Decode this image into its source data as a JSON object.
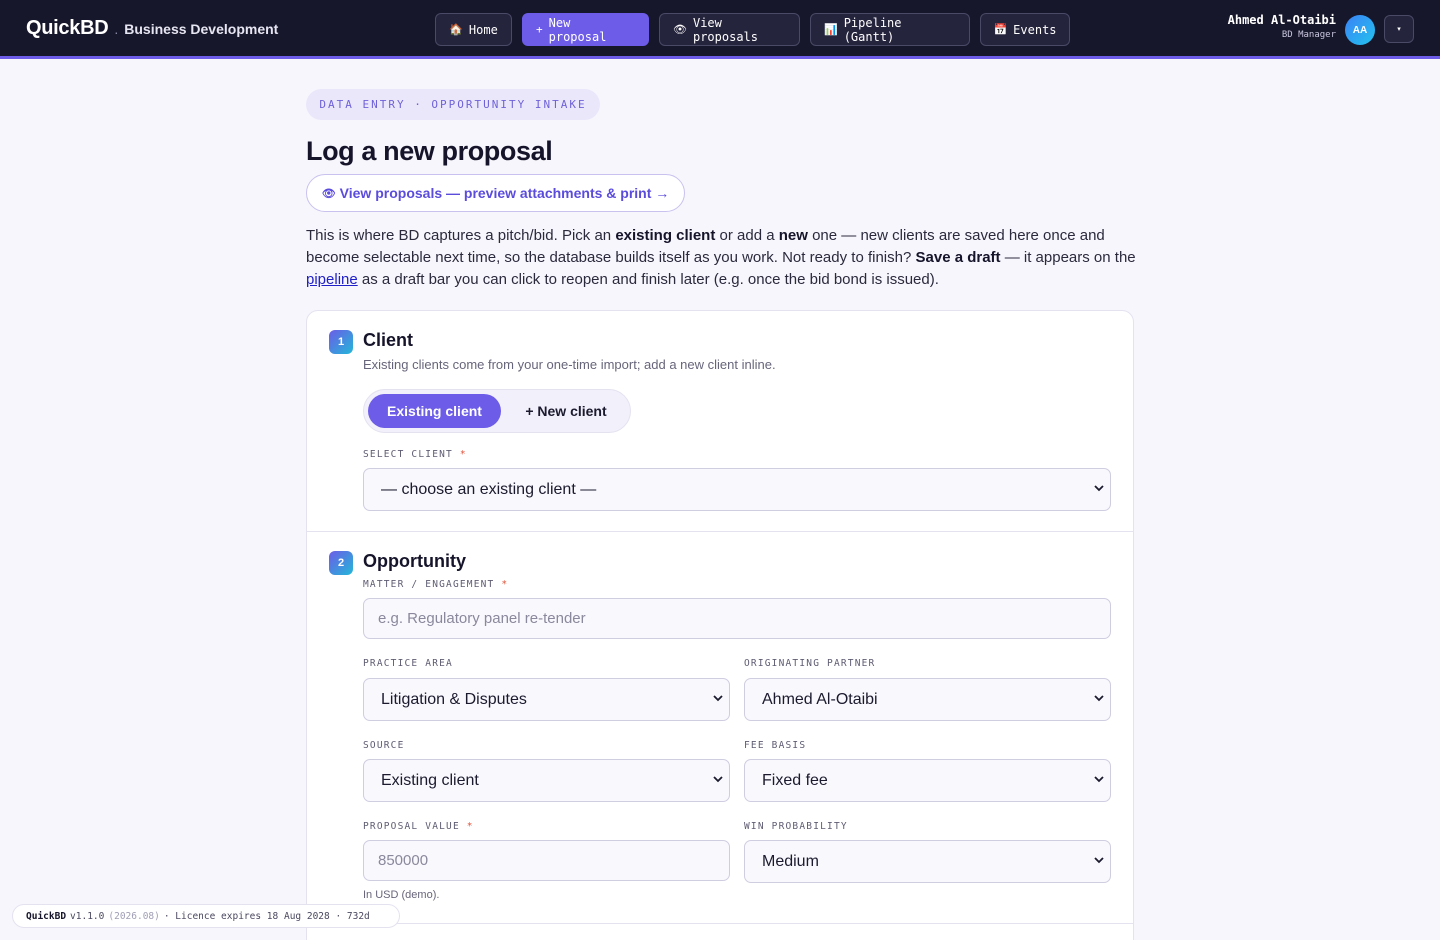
{
  "app": {
    "brand_name": "QuickBD",
    "brand_separator": ".",
    "brand_subtitle": "Business Development"
  },
  "nav": [
    {
      "label": "Home",
      "icon": "home-icon",
      "glyph": "🏠"
    },
    {
      "label": "New proposal",
      "icon": "plus-icon",
      "glyph": "+"
    },
    {
      "label": "View proposals",
      "icon": "eye-icon",
      "glyph": "👁"
    },
    {
      "label": "Pipeline (Gantt)",
      "icon": "chart-icon",
      "glyph": "📊"
    },
    {
      "label": "Events",
      "icon": "calendar-icon",
      "glyph": "📅"
    }
  ],
  "user": {
    "name": "Ahmed Al-Otaibi",
    "role": "BD Manager",
    "initials": "AA",
    "menu_glyph": "▾"
  },
  "header": {
    "eyebrow": "DATA ENTRY · OPPORTUNITY INTAKE",
    "title": "Log a new proposal",
    "view_link_icon": "👁",
    "view_link_label": "View proposals — preview attachments & print →"
  },
  "intro": {
    "p1": "This is where BD captures a pitch/bid. Pick an ",
    "b1": "existing client",
    "p2": " or add a ",
    "b2": "new",
    "p3": " one — new clients are saved here once and become selectable next time, so the database builds itself as you work. Not ready to finish? ",
    "b3": "Save a draft",
    "p4": " — it appears on the ",
    "link": "pipeline",
    "p5": " as a draft bar you can click to reopen and finish later (e.g. once the bid bond is issued)."
  },
  "client_section": {
    "number": "1",
    "title": "Client",
    "description": "Existing clients come from your one-time import; add a new client inline.",
    "toggle_existing": "Existing client",
    "toggle_new": "+  New client",
    "select_label": "SELECT CLIENT",
    "required_mark": "*",
    "select_value": "— choose an existing client —"
  },
  "opportunity_section": {
    "number": "2",
    "title": "Opportunity",
    "matter_label": "MATTER / ENGAGEMENT",
    "matter_placeholder": "e.g. Regulatory panel re-tender",
    "practice_area_label": "PRACTICE AREA",
    "practice_area_value": "Litigation & Disputes",
    "originating_partner_label": "ORIGINATING PARTNER",
    "originating_partner_value": "Ahmed Al-Otaibi",
    "source_label": "SOURCE",
    "source_value": "Existing client",
    "fee_basis_label": "FEE BASIS",
    "fee_basis_value": "Fixed fee",
    "proposal_value_label": "PROPOSAL VALUE",
    "proposal_value_placeholder": "850000",
    "proposal_value_hint": "In USD (demo).",
    "win_probability_label": "WIN PROBABILITY",
    "win_probability_value": "Medium",
    "required_mark": "*"
  },
  "footer": {
    "app": "QuickBD",
    "version": "v1.1.0",
    "build": "(2026.08)",
    "licence": "· Licence expires 18 Aug 2028 · 732d"
  },
  "colors": {
    "accent": "#6c5ce7",
    "topbar": "#17172b",
    "required": "#e0533b"
  }
}
